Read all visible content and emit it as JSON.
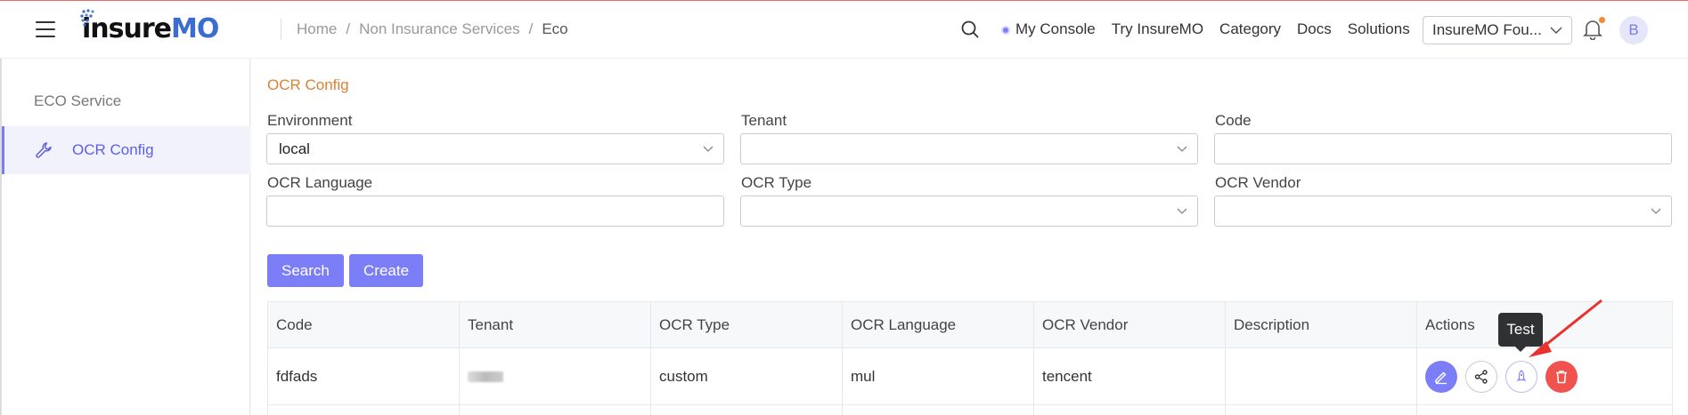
{
  "header": {
    "logo_prefix": "insure",
    "logo_suffix": "MO",
    "breadcrumb": [
      "Home",
      "Non Insurance Services",
      "Eco"
    ],
    "nav": [
      "My Console",
      "Try InsureMO",
      "Category",
      "Docs",
      "Solutions"
    ],
    "org_select": "InsureMO Fou...",
    "avatar": "B"
  },
  "sidebar": {
    "group": "ECO Service",
    "items": [
      {
        "label": "OCR Config"
      }
    ]
  },
  "main": {
    "title": "OCR Config",
    "fields": {
      "environment": {
        "label": "Environment",
        "value": "local"
      },
      "tenant": {
        "label": "Tenant",
        "value": ""
      },
      "code": {
        "label": "Code",
        "value": ""
      },
      "ocr_language": {
        "label": "OCR Language",
        "value": ""
      },
      "ocr_type": {
        "label": "OCR Type",
        "value": ""
      },
      "ocr_vendor": {
        "label": "OCR Vendor",
        "value": ""
      }
    },
    "buttons": {
      "search": "Search",
      "create": "Create"
    },
    "table": {
      "headers": [
        "Code",
        "Tenant",
        "OCR Type",
        "OCR Language",
        "OCR Vendor",
        "Description",
        "Actions"
      ],
      "rows": [
        {
          "code": "fdfads",
          "tenant": "",
          "ocr_type": "custom",
          "ocr_language": "mul",
          "ocr_vendor": "tencent",
          "description": ""
        }
      ]
    },
    "tooltip": "Test"
  },
  "colors": {
    "accent": "#7b7ef7",
    "danger": "#f0534e",
    "title": "#e08030"
  }
}
